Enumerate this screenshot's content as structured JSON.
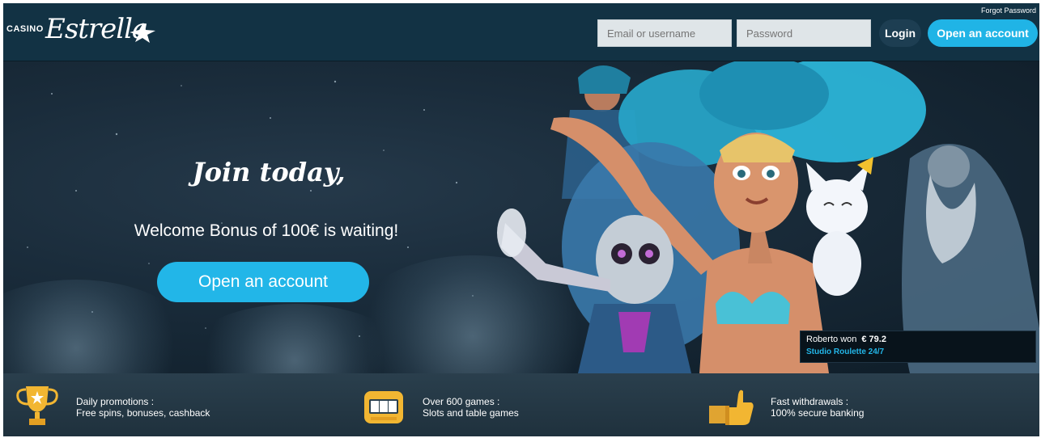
{
  "header": {
    "logo_prefix": "CASINO",
    "logo_name": "Estrella",
    "forgot_password": "Forgot Password",
    "email_placeholder": "Email or username",
    "password_placeholder": "Password",
    "login_label": "Login",
    "open_account_label": "Open an account"
  },
  "hero": {
    "title": "Join today,",
    "subtitle": "Welcome Bonus of 100€ is waiting!",
    "cta_label": "Open an account"
  },
  "winner_ticker": {
    "text": "Roberto won",
    "amount": "€ 79.2",
    "game": "Studio Roulette 24/7"
  },
  "features": [
    {
      "icon": "trophy-icon",
      "title": "Daily promotions :",
      "text": "Free spins, bonuses, cashback"
    },
    {
      "icon": "slot-machine-icon",
      "title": "Over 600 games :",
      "text": "Slots and table games"
    },
    {
      "icon": "thumbs-up-icon",
      "title": "Fast withdrawals :",
      "text": "100% secure banking"
    }
  ],
  "colors": {
    "header_bg": "#123244",
    "accent": "#20b4e6",
    "input_bg": "#dfe5e8",
    "feature_bar_bg": "#2a3f4d"
  }
}
